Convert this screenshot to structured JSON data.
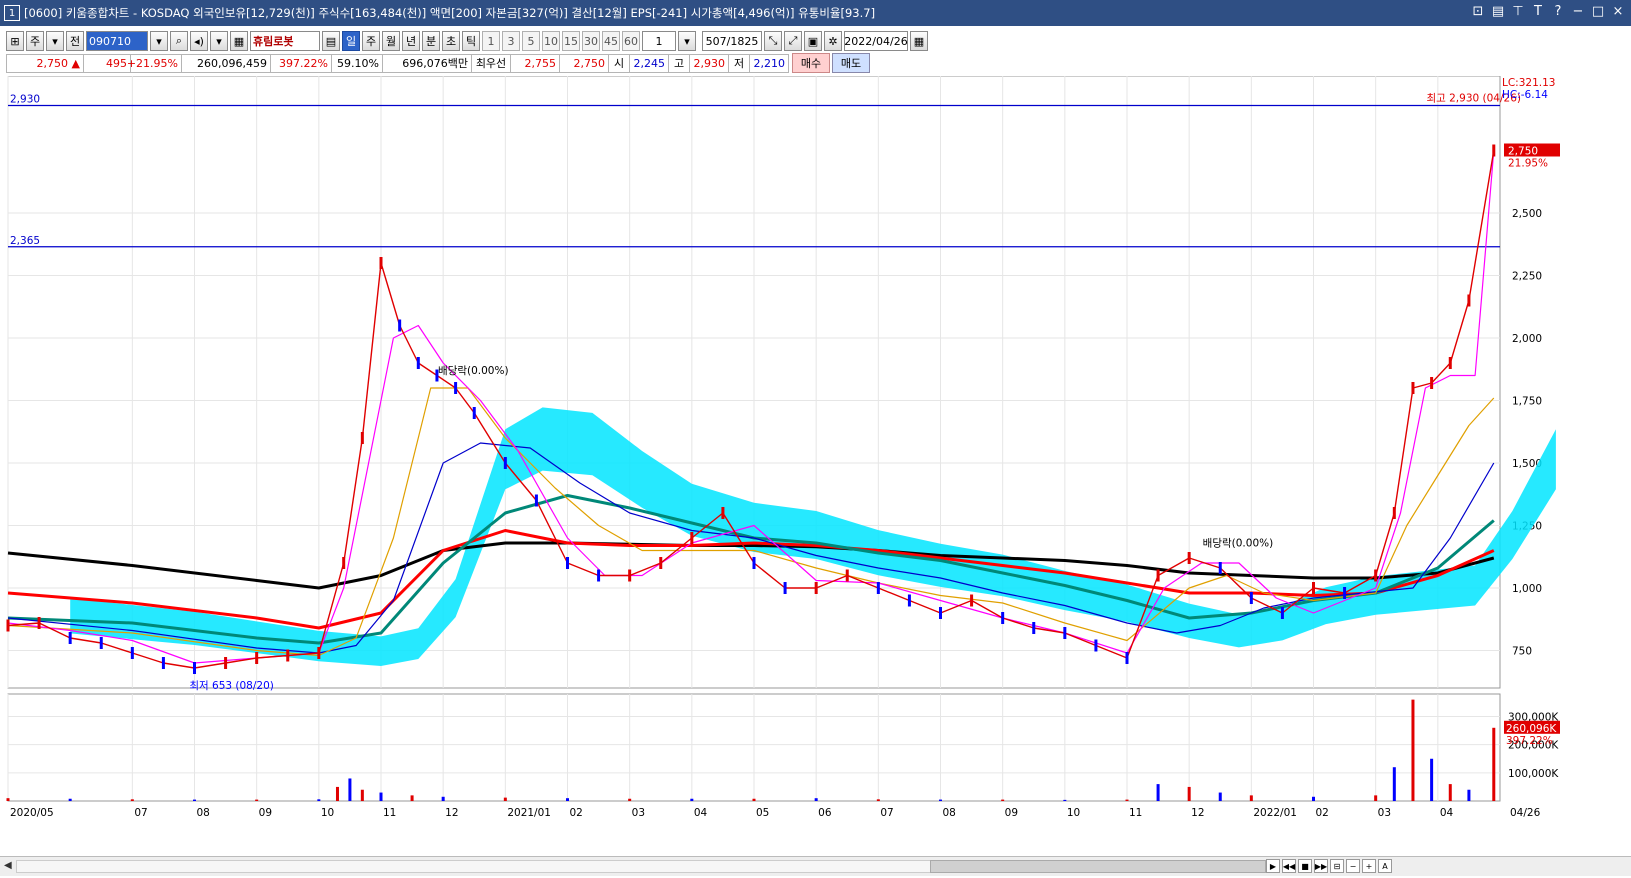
{
  "window": {
    "app_number": "1",
    "title": "[0600] 키움종합차트 - KOSDAQ 외국인보유[12,729(천)] 주식수[163,484(천)] 액면[200] 자본금[327(억)] 결산[12월] EPS[-241] 시가총액[4,496(억)] 유통비율[93.7]"
  },
  "toolbar": {
    "period_label": "주",
    "prev_label": "전",
    "stock_code": "090710",
    "stock_name": "휴림로봇",
    "intervals": [
      "일",
      "주",
      "월",
      "년",
      "분",
      "초",
      "틱"
    ],
    "active_interval": "일",
    "numbers": [
      "1",
      "3",
      "5",
      "10",
      "15",
      "30",
      "45",
      "60"
    ],
    "count": "1",
    "range": "507/1825",
    "date": "2022/04/26"
  },
  "quote": {
    "price": "2,750",
    "change": "495",
    "change_pct": "+21.95%",
    "volume": "260,096,459",
    "vol_ratio": "397.22%",
    "pct2": "59.10%",
    "amount": "696,076백만",
    "best_ask_label": "최우선",
    "best_ask": "2,755",
    "best_bid": "2,750",
    "open_label": "시",
    "open": "2,245",
    "high_label": "고",
    "high": "2,930",
    "low_label": "저",
    "low": "2,210",
    "buy_label": "매수",
    "sell_label": "매도"
  },
  "colors": {
    "price_up": "#e00000",
    "price_down": "#0000ff",
    "ichimoku": "#00e5ff",
    "ma5": "#ff00ff",
    "ma10": "#00b4e0",
    "ma20": "#e0a000",
    "ma60": "#0000cc",
    "ma120": "#008878",
    "ma240": "#ff0000",
    "ma480": "#000000",
    "hline": "#0000cc"
  },
  "chart_data": {
    "type": "line",
    "price_axis": {
      "ticks": [
        750,
        1000,
        1250,
        1500,
        1750,
        2000,
        2250,
        2500
      ],
      "tick_labels": [
        "750",
        "1,000",
        "1,250",
        "1,500",
        "1,750",
        "2,000",
        "2,250",
        "2,500"
      ],
      "ylim": [
        600,
        3000
      ]
    },
    "volume_axis": {
      "ticks": [
        100000,
        200000,
        300000
      ],
      "tick_labels": [
        "100,000K",
        "200,000K",
        "300,000K"
      ],
      "ylim": [
        0,
        380000
      ]
    },
    "x_labels": [
      "2020/05",
      "07",
      "08",
      "09",
      "10",
      "11",
      "12",
      "2021/01",
      "02",
      "03",
      "04",
      "05",
      "06",
      "07",
      "08",
      "09",
      "10",
      "11",
      "12",
      "2022/01",
      "02",
      "03",
      "04"
    ],
    "x_label_positions": [
      0,
      2,
      3,
      4,
      5,
      6,
      7,
      8,
      9,
      10,
      11,
      12,
      13,
      14,
      15,
      16,
      17,
      18,
      19,
      20,
      21,
      22,
      23
    ],
    "last_date_label": "04/26",
    "months_total": 24,
    "hlines": [
      {
        "value": 2930,
        "label": "2,930"
      },
      {
        "value": 2365,
        "label": "2,365"
      }
    ],
    "annotations": [
      {
        "text": "최고 2,930 (04/26)",
        "x": 23.3,
        "y": 2930
      },
      {
        "text": "최저 653 (08/20)",
        "x": 3.4,
        "y": 653
      },
      {
        "text": "배당락(0.00%)",
        "x": 7.4,
        "y": 1840
      },
      {
        "text": "배당락(0.00%)",
        "x": 19.7,
        "y": 1150
      }
    ],
    "right_labels": {
      "lc": "LC:321.13",
      "hc": "HC:-6.14",
      "last_price": "2,750",
      "last_pct": "21.95%",
      "last_volume": "260,096K",
      "last_vol_pct": "397.22%"
    },
    "series": [
      {
        "name": "close",
        "x": [
          0,
          0.5,
          1,
          1.5,
          2,
          2.5,
          3,
          3.5,
          4,
          4.5,
          5,
          5.4,
          5.7,
          6.0,
          6.3,
          6.6,
          6.9,
          7.2,
          7.5,
          8,
          8.5,
          9,
          9.5,
          10,
          10.5,
          11,
          11.5,
          12,
          12.5,
          13,
          13.5,
          14,
          14.5,
          15,
          15.5,
          16,
          16.5,
          17,
          17.5,
          18,
          18.5,
          19,
          19.5,
          20,
          20.5,
          21,
          21.5,
          22,
          22.3,
          22.6,
          22.9,
          23.2,
          23.5,
          23.9
        ],
        "y": [
          850,
          860,
          800,
          780,
          740,
          700,
          680,
          700,
          720,
          730,
          740,
          1100,
          1600,
          2300,
          2050,
          1900,
          1850,
          1800,
          1700,
          1500,
          1350,
          1100,
          1050,
          1050,
          1100,
          1200,
          1300,
          1100,
          1000,
          1000,
          1050,
          1000,
          950,
          900,
          950,
          880,
          840,
          820,
          770,
          720,
          1050,
          1120,
          1080,
          960,
          900,
          1000,
          980,
          1050,
          1300,
          1800,
          1820,
          1900,
          2150,
          2750
        ]
      },
      {
        "name": "ma60",
        "x": [
          0,
          2,
          4,
          5,
          5.6,
          6.2,
          7,
          7.6,
          8.4,
          9.2,
          10,
          11,
          12,
          13,
          14,
          15,
          16,
          17,
          18,
          18.8,
          19.5,
          20.2,
          21,
          21.8,
          22.6,
          23.2,
          23.9
        ],
        "y": [
          880,
          830,
          760,
          740,
          770,
          950,
          1500,
          1580,
          1560,
          1420,
          1300,
          1230,
          1200,
          1130,
          1080,
          1040,
          980,
          930,
          860,
          820,
          850,
          920,
          960,
          980,
          1000,
          1200,
          1500
        ]
      },
      {
        "name": "ma120",
        "x": [
          0,
          2,
          4,
          5,
          6,
          7,
          8,
          9,
          10,
          11,
          12,
          13,
          14,
          15,
          16,
          17,
          18,
          19,
          20,
          21,
          22,
          23,
          23.9
        ],
        "y": [
          880,
          860,
          800,
          780,
          820,
          1100,
          1300,
          1370,
          1320,
          1260,
          1200,
          1180,
          1140,
          1110,
          1060,
          1010,
          950,
          880,
          900,
          950,
          980,
          1080,
          1270
        ]
      },
      {
        "name": "ma240",
        "x": [
          0,
          2,
          4,
          5,
          6,
          7,
          8,
          9,
          10,
          11,
          12,
          13,
          14,
          15,
          16,
          17,
          18,
          19,
          20,
          21,
          22,
          23,
          23.9
        ],
        "y": [
          980,
          940,
          880,
          840,
          900,
          1150,
          1230,
          1180,
          1170,
          1170,
          1180,
          1170,
          1150,
          1120,
          1090,
          1060,
          1020,
          980,
          980,
          970,
          980,
          1050,
          1150
        ]
      },
      {
        "name": "ma480",
        "x": [
          0,
          2,
          4,
          5,
          6,
          7,
          8,
          9,
          10,
          11,
          12,
          13,
          14,
          15,
          16,
          17,
          18,
          19,
          20,
          21,
          22,
          23,
          23.9
        ],
        "y": [
          1140,
          1090,
          1030,
          1000,
          1050,
          1150,
          1180,
          1180,
          1175,
          1170,
          1170,
          1165,
          1150,
          1130,
          1120,
          1110,
          1090,
          1060,
          1050,
          1040,
          1040,
          1060,
          1120
        ]
      },
      {
        "name": "ma20",
        "x": [
          0,
          2,
          4,
          5,
          5.6,
          6.2,
          6.8,
          7.4,
          8,
          8.8,
          9.5,
          10.2,
          11,
          12,
          13,
          14,
          15,
          16,
          17,
          18,
          19,
          19.6,
          20.2,
          21,
          22,
          22.5,
          23,
          23.5,
          23.9
        ],
        "y": [
          850,
          820,
          750,
          730,
          800,
          1200,
          1800,
          1800,
          1600,
          1400,
          1250,
          1150,
          1150,
          1150,
          1080,
          1020,
          970,
          940,
          860,
          790,
          1000,
          1050,
          980,
          950,
          980,
          1250,
          1450,
          1650,
          1760
        ]
      },
      {
        "name": "ma5",
        "x": [
          0,
          1,
          2,
          3,
          4,
          5,
          5.4,
          5.8,
          6.2,
          6.6,
          7,
          7.6,
          8.2,
          9,
          9.6,
          10.2,
          11,
          12,
          13,
          14,
          15,
          16,
          17,
          18,
          18.6,
          19.2,
          19.8,
          20.4,
          21,
          22,
          22.4,
          22.8,
          23.2,
          23.6,
          23.9
        ],
        "y": [
          860,
          830,
          790,
          700,
          720,
          740,
          1000,
          1500,
          2000,
          2050,
          1900,
          1750,
          1550,
          1200,
          1050,
          1050,
          1180,
          1250,
          1030,
          1020,
          950,
          880,
          820,
          740,
          1000,
          1100,
          1100,
          960,
          900,
          1000,
          1300,
          1800,
          1850,
          1850,
          2750
        ]
      }
    ],
    "volume_series": [
      {
        "name": "volume",
        "x": [
          0,
          1,
          2,
          3,
          4,
          5,
          5.3,
          5.5,
          5.7,
          6,
          6.5,
          7,
          8,
          9,
          10,
          11,
          12,
          13,
          14,
          15,
          16,
          17,
          18,
          18.5,
          19,
          19.5,
          20,
          21,
          22,
          22.3,
          22.6,
          22.9,
          23.2,
          23.5,
          23.9
        ],
        "y": [
          10000,
          8000,
          6000,
          5000,
          5000,
          6000,
          50000,
          80000,
          40000,
          30000,
          20000,
          15000,
          12000,
          10000,
          8000,
          8000,
          8000,
          10000,
          6000,
          5000,
          5000,
          4000,
          5000,
          60000,
          50000,
          30000,
          20000,
          15000,
          20000,
          120000,
          360000,
          150000,
          60000,
          40000,
          260000
        ]
      }
    ]
  }
}
